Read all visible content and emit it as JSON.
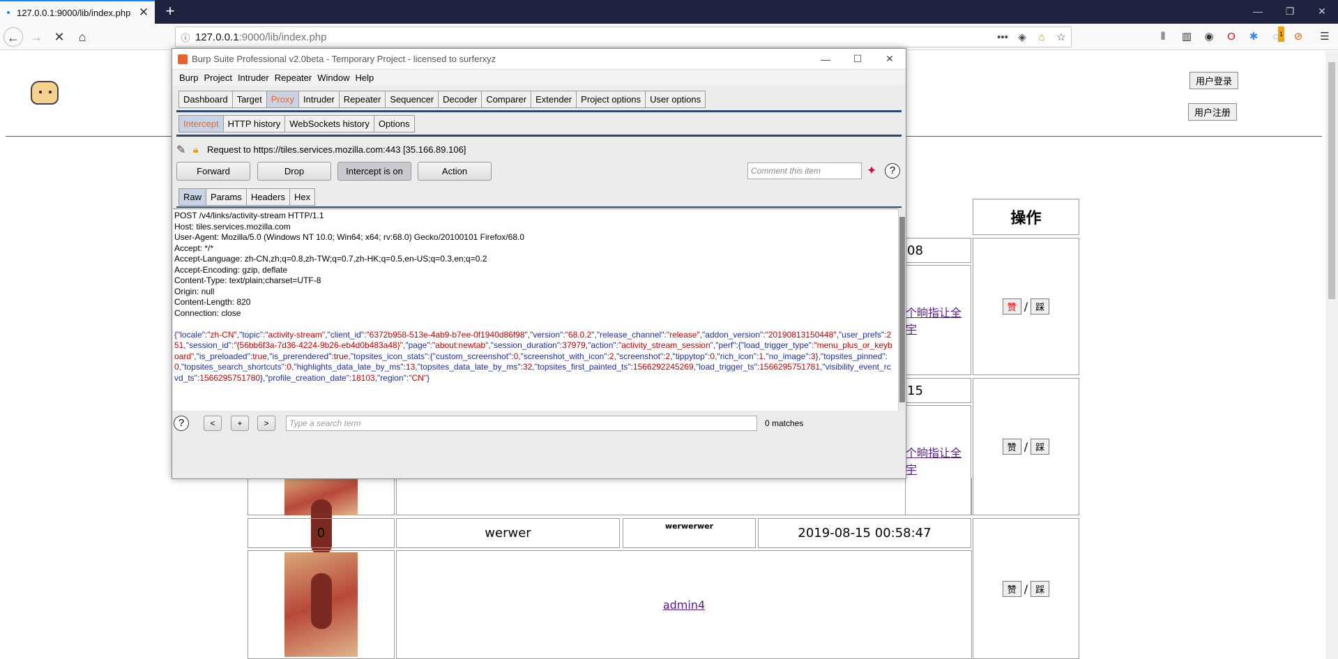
{
  "browser": {
    "tab_title": "127.0.0.1:9000/lib/index.php",
    "url_host": "127.0.0.1",
    "url_rest": ":9000/lib/index.php",
    "badge_count": "1"
  },
  "page": {
    "login_label": "用户登录",
    "register_label": "用户注册",
    "header_action": "操作",
    "vote_up": "赞",
    "vote_down": "踩",
    "vote_sep": "/",
    "rows": [
      {
        "date_fragment": "08",
        "link_fragment": "​个晌指让全宇"
      },
      {
        "date_fragment": "15",
        "link_fragment": "​个晌指让全宇"
      }
    ],
    "row3": {
      "likes": "0",
      "author": "werwer",
      "content_small": "werwerwer",
      "date": "2019-08-15 00:58:47",
      "link": "admin4"
    }
  },
  "burp": {
    "title": "Burp Suite Professional v2.0beta - Temporary Project - licensed to surferxyz",
    "menu": [
      "Burp",
      "Project",
      "Intruder",
      "Repeater",
      "Window",
      "Help"
    ],
    "main_tabs": [
      "Dashboard",
      "Target",
      "Proxy",
      "Intruder",
      "Repeater",
      "Sequencer",
      "Decoder",
      "Comparer",
      "Extender",
      "Project options",
      "User options"
    ],
    "proxy_tabs": [
      "Intercept",
      "HTTP history",
      "WebSockets history",
      "Options"
    ],
    "request_to": "Request to https://tiles.services.mozilla.com:443  [35.166.89.106]",
    "buttons": {
      "forward": "Forward",
      "drop": "Drop",
      "intercept": "Intercept is on",
      "action": "Action"
    },
    "comment_placeholder": "Comment this item",
    "msg_tabs": [
      "Raw",
      "Params",
      "Headers",
      "Hex"
    ],
    "request_lines": [
      "POST /v4/links/activity-stream HTTP/1.1",
      "Host: tiles.services.mozilla.com",
      "User-Agent: Mozilla/5.0 (Windows NT 10.0; Win64; x64; rv:68.0) Gecko/20100101 Firefox/68.0",
      "Accept: */*",
      "Accept-Language: zh-CN,zh;q=0.8,zh-TW;q=0.7,zh-HK;q=0.5,en-US;q=0.3,en;q=0.2",
      "Accept-Encoding: gzip, deflate",
      "Content-Type: text/plain;charset=UTF-8",
      "Origin: null",
      "Content-Length: 820",
      "Connection: close"
    ],
    "body_parts": [
      [
        "k",
        "{\"locale\":"
      ],
      [
        "v",
        "\"zh-CN\""
      ],
      [
        "k",
        ",\"topic\":"
      ],
      [
        "v",
        "\"activity-stream\""
      ],
      [
        "k",
        ",\"client_id\":"
      ],
      [
        "v",
        "\"6372b958-513e-4ab9-b7ee-0f1940d86f98\""
      ],
      [
        "k",
        ",\"version\":"
      ],
      [
        "v",
        "\"68.0.2\""
      ],
      [
        "k",
        ",\"release_channel\":"
      ],
      [
        "v",
        "\"release\""
      ],
      [
        "k",
        ",\"addon_version\":"
      ],
      [
        "v",
        "\"20190813150448\""
      ],
      [
        "k",
        ",\"user_prefs\":"
      ],
      [
        "v",
        "251"
      ],
      [
        "k",
        ",\"session_id\":"
      ],
      [
        "v",
        "\"{56bb6f3a-7d36-4224-9b26-eb4d0b483a48}\""
      ],
      [
        "k",
        ",\"page\":"
      ],
      [
        "v",
        "\"about:newtab\""
      ],
      [
        "k",
        ",\"session_duration\":"
      ],
      [
        "v",
        "37979"
      ],
      [
        "k",
        ",\"action\":"
      ],
      [
        "v",
        "\"activity_stream_session\""
      ],
      [
        "k",
        ",\"perf\":{\"load_trigger_type\":"
      ],
      [
        "v",
        "\"menu_plus_or_keyboard\""
      ],
      [
        "k",
        ",\"is_preloaded\":"
      ],
      [
        "v",
        "true"
      ],
      [
        "k",
        ",\"is_prerendered\":"
      ],
      [
        "v",
        "true"
      ],
      [
        "k",
        ",\"topsites_icon_stats\":{\"custom_screenshot\":"
      ],
      [
        "v",
        "0"
      ],
      [
        "k",
        ",\"screenshot_with_icon\":"
      ],
      [
        "v",
        "2"
      ],
      [
        "k",
        ",\"screenshot\":"
      ],
      [
        "v",
        "2"
      ],
      [
        "k",
        ",\"tippytop\":"
      ],
      [
        "v",
        "0"
      ],
      [
        "k",
        ",\"rich_icon\":"
      ],
      [
        "v",
        "1"
      ],
      [
        "k",
        ",\"no_image\":"
      ],
      [
        "v",
        "3"
      ],
      [
        "k",
        "},\"topsites_pinned\":"
      ],
      [
        "v",
        "0"
      ],
      [
        "k",
        ",\"topsites_search_shortcuts\":"
      ],
      [
        "v",
        "0"
      ],
      [
        "k",
        ",\"highlights_data_late_by_ms\":"
      ],
      [
        "v",
        "13"
      ],
      [
        "k",
        ",\"topsites_data_late_by_ms\":"
      ],
      [
        "v",
        "32"
      ],
      [
        "k",
        ",\"topsites_first_painted_ts\":"
      ],
      [
        "v",
        "1566292245269"
      ],
      [
        "k",
        ",\"load_trigger_ts\":"
      ],
      [
        "v",
        "1566295751781"
      ],
      [
        "k",
        ",\"visibility_event_rcvd_ts\":"
      ],
      [
        "v",
        "1566295751780"
      ],
      [
        "k",
        "},\"profile_creation_date\":"
      ],
      [
        "v",
        "18103"
      ],
      [
        "k",
        ",\"region\":"
      ],
      [
        "v",
        "\"CN\""
      ],
      [
        "k",
        "}"
      ]
    ],
    "search_placeholder": "Type a search term",
    "matches": "0 matches",
    "nav": {
      "prev": "<",
      "add": "+",
      "next": ">"
    }
  }
}
